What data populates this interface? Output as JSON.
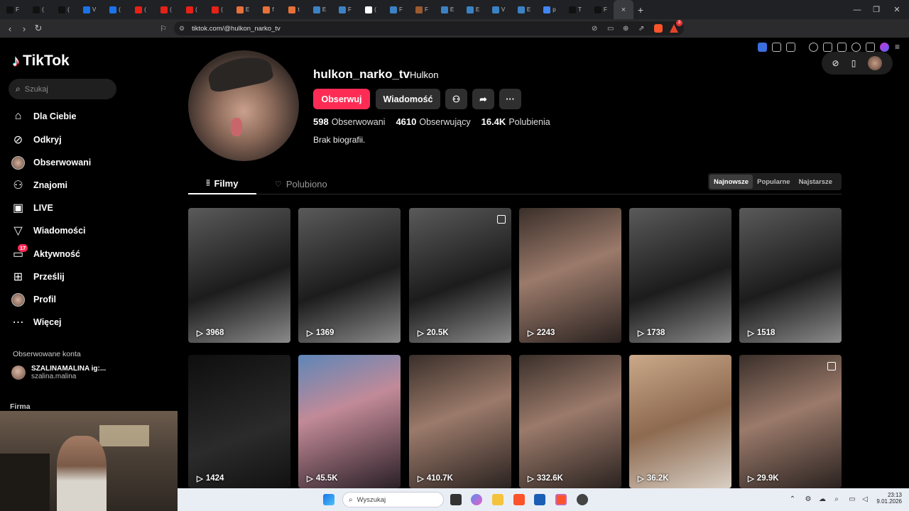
{
  "browser": {
    "tabs": [
      {
        "letter": "F",
        "color": "#111111"
      },
      {
        "letter": "(",
        "color": "#111111"
      },
      {
        "letter": "(",
        "color": "#111111"
      },
      {
        "letter": "V",
        "color": "#1a73e8"
      },
      {
        "letter": "(",
        "color": "#1a73e8"
      },
      {
        "letter": "(",
        "color": "#e62117"
      },
      {
        "letter": "(",
        "color": "#e62117"
      },
      {
        "letter": "(",
        "color": "#e62117"
      },
      {
        "letter": "(",
        "color": "#e62117"
      },
      {
        "letter": "E",
        "color": "#e8703a"
      },
      {
        "letter": "f",
        "color": "#e8703a"
      },
      {
        "letter": "t",
        "color": "#e8703a"
      },
      {
        "letter": "E",
        "color": "#3b82c4"
      },
      {
        "letter": "F",
        "color": "#3b82c4"
      },
      {
        "letter": "(",
        "color": "#ffffff"
      },
      {
        "letter": "F",
        "color": "#3b82c4"
      },
      {
        "letter": "F",
        "color": "#9c5a2e"
      },
      {
        "letter": "E",
        "color": "#3b82c4"
      },
      {
        "letter": "E",
        "color": "#3b82c4"
      },
      {
        "letter": "V",
        "color": "#3b82c4"
      },
      {
        "letter": "E",
        "color": "#3b82c4"
      },
      {
        "letter": "p",
        "color": "#4285f4"
      },
      {
        "letter": "T",
        "color": "#111111"
      },
      {
        "letter": "F",
        "color": "#111111"
      }
    ],
    "active_tab_icon": "×",
    "url": "tiktok.com/@hulkon_narko_tv",
    "extension_badge": "3"
  },
  "sidebar": {
    "logo_text": "TikTok",
    "search_placeholder": "Szukaj",
    "menu": [
      {
        "label": "Dla Ciebie",
        "icon": "home-icon",
        "glyph": "⌂"
      },
      {
        "label": "Odkryj",
        "icon": "compass-icon",
        "glyph": "⊘"
      },
      {
        "label": "Obserwowani",
        "icon": "following-avatar-icon",
        "glyph": ""
      },
      {
        "label": "Znajomi",
        "icon": "friends-icon",
        "glyph": "⚇"
      },
      {
        "label": "LIVE",
        "icon": "live-icon",
        "glyph": "▣"
      },
      {
        "label": "Wiadomości",
        "icon": "messages-icon",
        "glyph": "▽"
      },
      {
        "label": "Aktywność",
        "icon": "activity-icon",
        "glyph": "▭",
        "badge": "17"
      },
      {
        "label": "Prześlij",
        "icon": "upload-icon",
        "glyph": "⊞"
      },
      {
        "label": "Profil",
        "icon": "profile-avatar-icon",
        "glyph": ""
      },
      {
        "label": "Więcej",
        "icon": "more-icon",
        "glyph": "⋯"
      }
    ],
    "followed_title": "Obserwowane konta",
    "followed_account": {
      "name": "SZALINAMALINA ig:...",
      "handle": "szalina.malina"
    },
    "footer_heading": "Firma"
  },
  "profile": {
    "username": "hulkon_narko_tv",
    "nickname": "Hulkon",
    "follow_label": "Obserwuj",
    "message_label": "Wiadomość",
    "more_label": "···",
    "stats": [
      {
        "value": "598",
        "label": "Obserwowani"
      },
      {
        "value": "4610",
        "label": "Obserwujący"
      },
      {
        "value": "16.4K",
        "label": "Polubienia"
      }
    ],
    "bio": "Brak biografii."
  },
  "tabs": {
    "films": "Filmy",
    "liked": "Polubiono",
    "sort_options": [
      "Najnowsze",
      "Popularne",
      "Najstarsze"
    ],
    "sort_selected": "Najnowsze"
  },
  "videos": [
    {
      "views": "3968",
      "photo": false,
      "tone": "bw"
    },
    {
      "views": "1369",
      "photo": false,
      "tone": "bw"
    },
    {
      "views": "20.5K",
      "photo": true,
      "tone": "bw"
    },
    {
      "views": "2243",
      "photo": false,
      "tone": "warm"
    },
    {
      "views": "1738",
      "photo": false,
      "tone": "bw"
    },
    {
      "views": "1518",
      "photo": false,
      "tone": "bw"
    },
    {
      "views": "1424",
      "photo": false,
      "tone": "dark"
    },
    {
      "views": "45.5K",
      "photo": false,
      "tone": "pink"
    },
    {
      "views": "410.7K",
      "photo": false,
      "tone": "warm"
    },
    {
      "views": "332.6K",
      "photo": false,
      "tone": "warm"
    },
    {
      "views": "36.2K",
      "photo": false,
      "tone": "wood"
    },
    {
      "views": "29.9K",
      "photo": true,
      "tone": "warm"
    }
  ],
  "taskbar": {
    "search_placeholder": "Wyszukaj",
    "time": "23:13",
    "date": "9.01.2026"
  }
}
